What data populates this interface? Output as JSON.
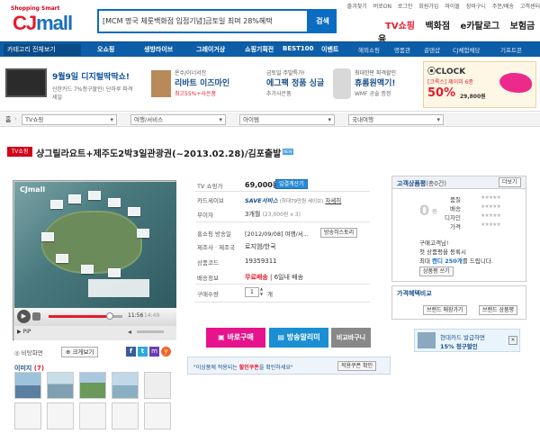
{
  "header": {
    "logo_small": "Shopping Smart",
    "logo_cj": "CJ",
    "logo_mall": "mall",
    "search_value": "[MCM 명국 체룻백화점 입점기념]금토일 최며 28%혜택",
    "search_button": "검색",
    "util_links": [
      "즐겨찾기",
      "버로ON",
      "로그인",
      "회원가입",
      "마이몰",
      "장바구니",
      "주문/배송",
      "고객센터"
    ],
    "big_menu": [
      "TV쇼핑",
      "백화점",
      "e카탈로그",
      "보험금융"
    ]
  },
  "nav": {
    "category_all": "카테고리 전체보기",
    "items": [
      "오쇼핑",
      "생방라이브",
      "그레이거상",
      "쇼핑기획전",
      "BEST100",
      "이벤트"
    ],
    "right_links": [
      "해외쇼핑",
      "명품관",
      "골덴샵",
      "CJ체험채당",
      "기프트콘"
    ]
  },
  "banners": [
    {
      "t1": "9월9일",
      "t2": "9월9일 디지털딱딱쇼!",
      "t3": "신한카드 7%청구할인! 단하루 파격세일"
    },
    {
      "t1": "온수/이너서잔",
      "t2": "리바트 이즈마인",
      "t3": "최고55%+사은품"
    },
    {
      "t1": "금토일 주말특가!",
      "t2": "에그팩 정품 싱글",
      "t3": "추가사은품"
    },
    {
      "t1": "최대한판 파격할인",
      "t2": "휴롬원액기!",
      "t3": "WMF 공술 증정"
    },
    {
      "t1": "[크록스] 제이미 6종",
      "t2": "50%",
      "t3": "29,800원"
    }
  ],
  "breadcrumb": {
    "home": "홈",
    "cat1": "TV쇼핑",
    "cat2": "여행/서비스",
    "cat3": "아이템",
    "cat4": "국내여행"
  },
  "product": {
    "badge": "TV쇼핑",
    "title": "샹그릴라요트+제주도2박3일관광권(~2013.02.28)/김포출발",
    "new_badge": "NEW"
  },
  "player": {
    "logo": "CJmall",
    "time_current": "11:56",
    "time_total": "14:49",
    "pip": "▶ PIP",
    "bookmark": "비탕화면",
    "zoom": "크게보기",
    "play_icon": "▶"
  },
  "info": {
    "price_label": "TV 쇼핑가",
    "price": "69,000원",
    "installment_btn": "일결계산기",
    "card_label": "카드세이브",
    "card_save": "SAVE서비스",
    "card_save_note": "(최대79만원 세이브)",
    "card_detail": "자세히",
    "noint_label": "무이자",
    "noint_value": "3개월",
    "noint_note": "(23,000원 x 3)",
    "broadcast_label": "홍쇼핑 방송일",
    "broadcast_value": "[2012/09/08] 여행/서...",
    "broadcast_btn": "방송히스토리",
    "maker_label": "제조사 · 제조국",
    "maker_value": "로지엠/한국",
    "code_label": "상품코드",
    "code_value": "19359311",
    "ship_label": "배송정보",
    "ship_free": "무료배송",
    "ship_days": "6일내 배송",
    "qty_label": "구매수량",
    "qty_value": "1",
    "qty_unit": "개"
  },
  "actions": {
    "buy": "바로구매",
    "alarm": "방송알리미",
    "compare": "비교바구니"
  },
  "coupon": {
    "text_pre": "\"이상품에 적용되는 ",
    "text_hl": "할인쿠폰",
    "text_post": "을 확인하세요\"",
    "btn": "적용쿠폰 확인"
  },
  "review": {
    "title": "고객상품평",
    "count": "(총0건)",
    "more": "더보기",
    "score": "점",
    "score_num": "0",
    "rows": [
      "품질",
      "배송",
      "디자인",
      "가격"
    ],
    "stars": "★★★★★",
    "msg1": "구매고객님!",
    "msg2": "첫 상품평을 등록시",
    "msg3_pre": "최대 ",
    "msg3_hl": "캔디 250개",
    "msg3_post": "를 드립니다.",
    "write_btn": "상품평 쓰기"
  },
  "similar": {
    "title": "가격혜택비교",
    "btn1": "브랜드 매장가기",
    "btn2": "브랜드 상품평"
  },
  "card_promo": {
    "line1": "현대카드 발급하면",
    "line2_pre": "15%",
    "line2_post": " 청구할인"
  },
  "images": {
    "label": "이미지",
    "count": "(7)"
  },
  "colors": {
    "brand_blue": "#0b6cc1",
    "nav_blue": "#0d5ea8",
    "tv_red": "#d0021b",
    "buy_pink": "#e6138c",
    "alarm_blue": "#1a8fd4"
  }
}
